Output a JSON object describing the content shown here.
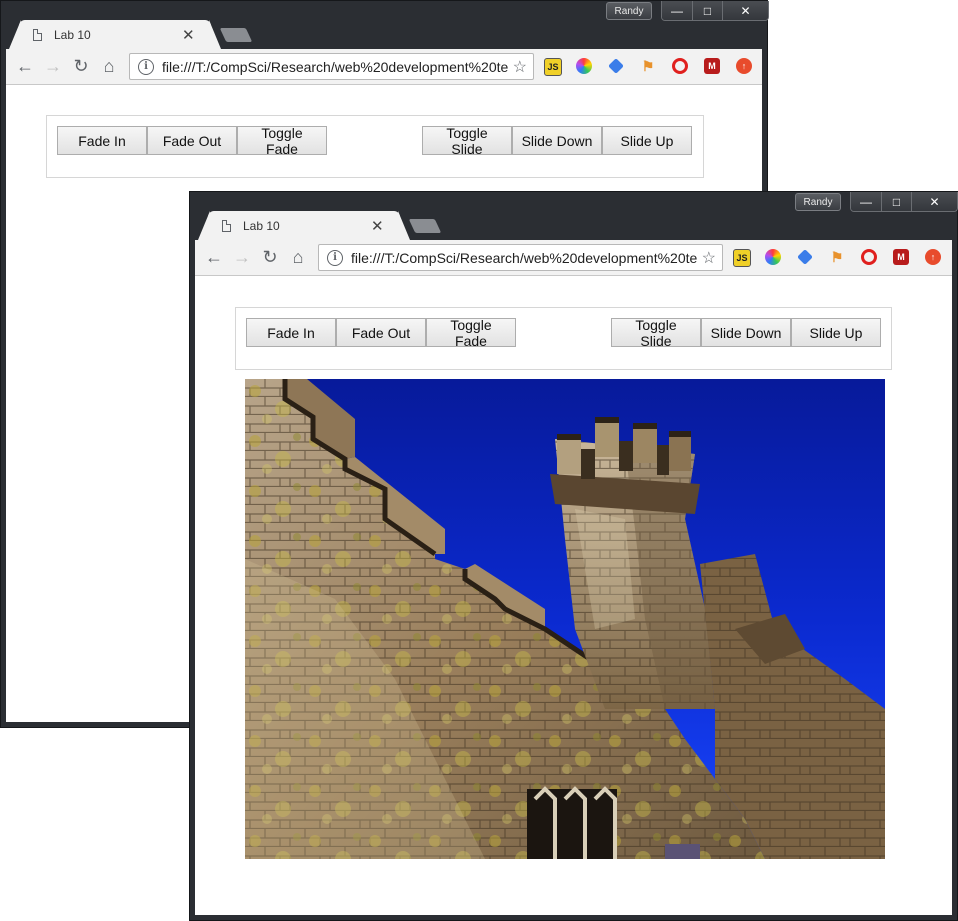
{
  "browser": {
    "profile_name": "Randy",
    "tab_title": "Lab 10",
    "address": "file:///T:/CompSci/Research/web%20development%20te",
    "window_controls": {
      "minimize": "minimize-icon",
      "maximize": "maximize-icon",
      "close": "close-icon"
    },
    "toolbar_icons": [
      "back-arrow-icon",
      "forward-arrow-icon",
      "reload-icon",
      "home-icon",
      "info-icon",
      "bookmark-star-icon"
    ],
    "extensions": [
      {
        "name": "js-extension-icon",
        "label": "JS",
        "color": "#f0d028"
      },
      {
        "name": "color-wheel-extension-icon",
        "label": "",
        "color": "#ff5a5a"
      },
      {
        "name": "blue-diamond-extension-icon",
        "label": "",
        "color": "#3b7de9"
      },
      {
        "name": "orange-flag-extension-icon",
        "label": "",
        "color": "#e8922c"
      },
      {
        "name": "opera-extension-icon",
        "label": "",
        "color": "#e0201e"
      },
      {
        "name": "red-m-extension-icon",
        "label": "",
        "color": "#b81c1c"
      },
      {
        "name": "red-upload-extension-icon",
        "label": "",
        "color": "#e84b2c"
      }
    ]
  },
  "page": {
    "buttons_left": [
      "Fade In",
      "Fade Out",
      "Toggle Fade"
    ],
    "buttons_right": [
      "Toggle Slide",
      "Slide Down",
      "Slide Up"
    ],
    "photo": {
      "subject": "castle-tower-photo",
      "sky_color": "#0b2ad0"
    }
  },
  "colors": {
    "frame": "#2b2e33",
    "tab": "#f2f2f2",
    "button_border": "#adadad"
  }
}
